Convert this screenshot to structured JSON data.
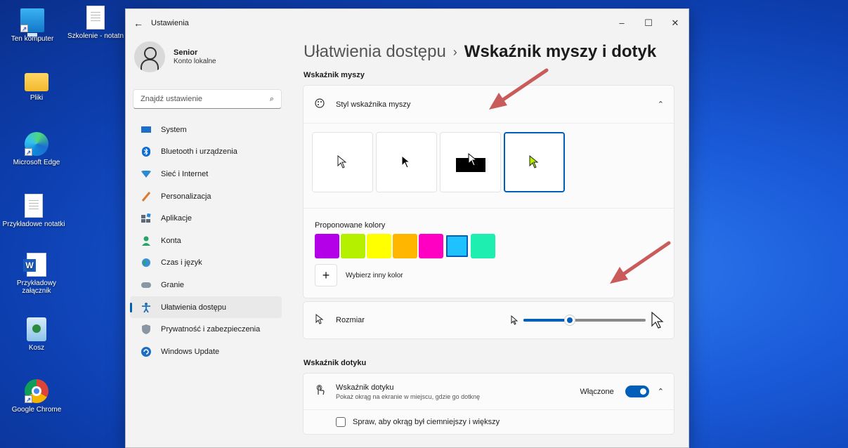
{
  "desktop": {
    "icons": [
      {
        "label": "Ten komputer",
        "icon": "computer-icon"
      },
      {
        "label": "Szkolenie - notatn",
        "icon": "document-icon"
      },
      {
        "label": "Pliki",
        "icon": "folder-icon"
      },
      {
        "label": "Microsoft Edge",
        "icon": "edge-icon"
      },
      {
        "label": "Przykładowe notatki",
        "icon": "document-icon"
      },
      {
        "label": "Przykładowy załącznik",
        "icon": "word-icon"
      },
      {
        "label": "Kosz",
        "icon": "recycle-bin-icon"
      },
      {
        "label": "Google Chrome",
        "icon": "chrome-icon"
      }
    ]
  },
  "window": {
    "title": "Ustawienia",
    "controls": {
      "minimize": "–",
      "maximize": "☐",
      "close": "✕"
    }
  },
  "profile": {
    "name": "Senior",
    "account": "Konto lokalne"
  },
  "search": {
    "placeholder": "Znajdź ustawienie"
  },
  "sidebar": {
    "items": [
      {
        "label": "System",
        "icon": "system-icon"
      },
      {
        "label": "Bluetooth i urządzenia",
        "icon": "bluetooth-icon"
      },
      {
        "label": "Sieć i Internet",
        "icon": "network-icon"
      },
      {
        "label": "Personalizacja",
        "icon": "brush-icon"
      },
      {
        "label": "Aplikacje",
        "icon": "apps-icon"
      },
      {
        "label": "Konta",
        "icon": "accounts-icon"
      },
      {
        "label": "Czas i język",
        "icon": "time-language-icon"
      },
      {
        "label": "Granie",
        "icon": "gaming-icon"
      },
      {
        "label": "Ułatwienia dostępu",
        "icon": "accessibility-icon",
        "active": true
      },
      {
        "label": "Prywatność i zabezpieczenia",
        "icon": "shield-icon"
      },
      {
        "label": "Windows Update",
        "icon": "update-icon"
      }
    ]
  },
  "breadcrumb": {
    "parent": "Ułatwienia dostępu",
    "separator": "›",
    "current": "Wskaźnik myszy i dotyk"
  },
  "mouse_pointer": {
    "section_title": "Wskaźnik myszy",
    "style_header": "Styl wskaźnika myszy",
    "styles": [
      {
        "name": "white",
        "selected": false
      },
      {
        "name": "black",
        "selected": false
      },
      {
        "name": "inverted",
        "selected": false
      },
      {
        "name": "custom",
        "selected": true
      }
    ],
    "colors_label": "Proponowane kolory",
    "colors": [
      "#b300e8",
      "#b5f000",
      "#ffff00",
      "#ffb600",
      "#ff00c3",
      "#1ec2ff",
      "#1eefb0"
    ],
    "selected_color_index": 5,
    "custom_color_label": "Wybierz inny kolor",
    "size_label": "Rozmiar",
    "size_value": 0.38
  },
  "touch": {
    "section_title": "Wskaźnik dotyku",
    "title": "Wskaźnik dotyku",
    "description": "Pokaż okrąg na ekranie w miejscu, gdzie go dotknę",
    "toggle_label": "Włączone",
    "checkbox_label": "Spraw, aby okrąg był ciemniejszy i większy"
  },
  "annotation_color": "#c95b5b",
  "accent_color": "#005fb8"
}
